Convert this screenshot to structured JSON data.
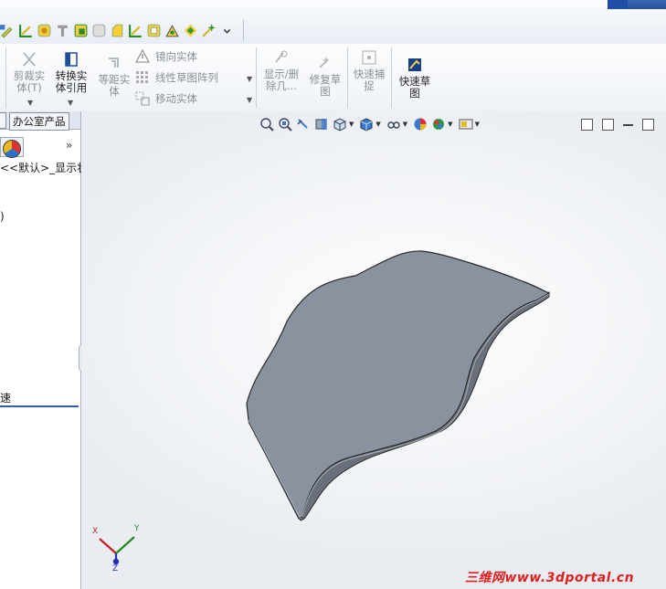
{
  "ribbon": {
    "trim": {
      "line1": "剪裁实",
      "line2": "体(T)"
    },
    "convert": {
      "line1": "转换实",
      "line2": "体引用"
    },
    "offset": {
      "line1": "等距实",
      "line2": "体"
    },
    "mirror": "镜向实体",
    "linear_pattern": "线性草图阵列",
    "move": "移动实体",
    "show_delete": {
      "line1": "显示/删",
      "line2": "除几..."
    },
    "repair": {
      "line1": "修复草",
      "line2": "图"
    },
    "quick_snap": {
      "line1": "快速捕",
      "line2": "捉"
    },
    "rapid_sketch": {
      "line1": "快速草",
      "line2": "图"
    }
  },
  "left_panel": {
    "tab_label": "办公室产品",
    "more": "»",
    "config_path": "<<默认>_显示状",
    "paren": ")",
    "speed": "速"
  },
  "graphics": {
    "triad": {
      "x": "X",
      "y": "Y",
      "z": "Z"
    },
    "watermark": "三维网www.3dportal.cn"
  },
  "colors": {
    "accent_blue": "#2a5fb0",
    "model_face": "#8b929f",
    "model_edge": "#333333",
    "watermark_red": "#e02020"
  }
}
